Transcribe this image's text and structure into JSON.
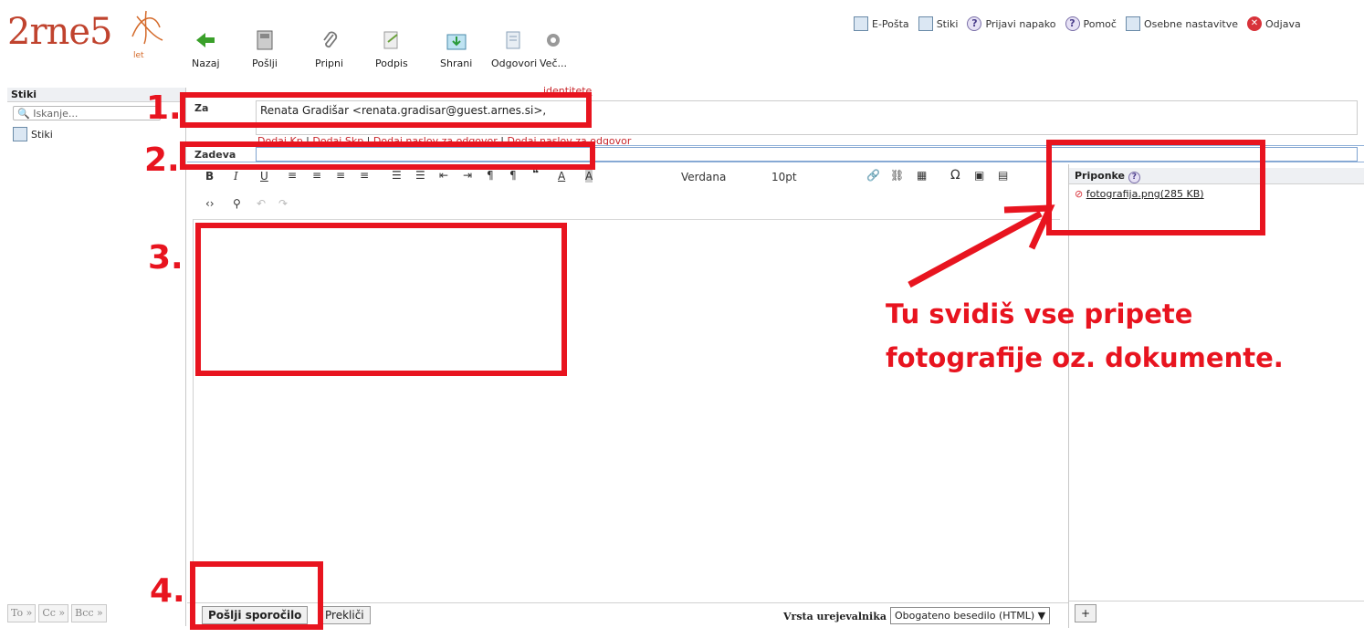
{
  "top_links": [
    "E-Pošta",
    "Stiki",
    "Prijavi napako",
    "Pomoč",
    "Osebne nastavitve",
    "Odjava"
  ],
  "logo": {
    "text": "2rne5",
    "sub": "let"
  },
  "toolbar": [
    "Nazaj",
    "Pošlji",
    "Pripni",
    "Podpis",
    "Shrani",
    "Odgovori",
    "Več..."
  ],
  "sidebar": {
    "title": "Stiki",
    "search_placeholder": "Iskanje...",
    "item": "Stiki",
    "bottom": [
      "To »",
      "Cc »",
      "Bcc »"
    ]
  },
  "compose": {
    "identity_link": "identitete",
    "to_label": "Za",
    "to_value": "Renata Gradišar <renata.gradisar@guest.arnes.si>,",
    "add_links": [
      "Dodaj Kp",
      "Dodaj Skp",
      "Dodaj naslov za odgovor",
      "Dodaj naslov za odgovor"
    ],
    "subject_label": "Zadeva",
    "subject_value": ""
  },
  "editor": {
    "font": "Verdana",
    "size": "10pt"
  },
  "bottom": {
    "send": "Pošlji sporočilo",
    "cancel": "Prekliči",
    "editor_type_label": "Vrsta urejevalnika",
    "editor_type_value": "Obogateno besedilo (HTML)",
    "add": "+"
  },
  "attachments": {
    "title": "Priponke",
    "file": "fotografija.png(285 KB)"
  },
  "annotations": {
    "n1": "1.",
    "n2": "2.",
    "n3": "3.",
    "n4": "4.",
    "note_line1": "Tu svidiš vse pripete",
    "note_line2": "fotografije oz. dokumente."
  },
  "colors": {
    "accent_red": "#e8141f",
    "link_red": "#c8262b",
    "logo_orange": "#c0432e"
  }
}
